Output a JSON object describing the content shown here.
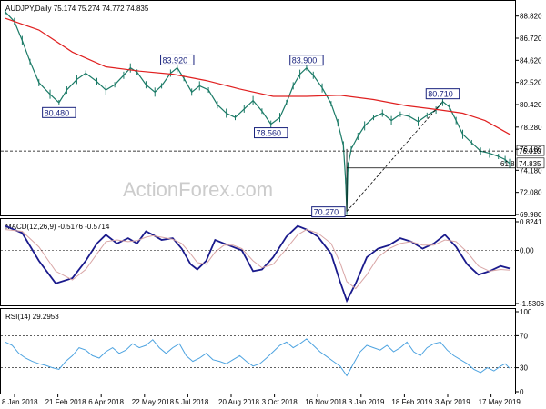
{
  "chart_data": [
    {
      "type": "ohlc",
      "header": "AUDJPY,Daily  75.174 75.274 74.772 74.835",
      "ylim": [
        69.98,
        90.0
      ],
      "y_ticks": [
        "88.820",
        "86.720",
        "84.620",
        "82.520",
        "80.420",
        "78.280",
        "76.180",
        "74.180",
        "72.080",
        "69.980"
      ],
      "y_tick_values": [
        88.82,
        86.72,
        84.62,
        82.52,
        80.42,
        78.28,
        76.18,
        74.18,
        72.08,
        69.98
      ],
      "x_labels": [
        "8 Jan 2018",
        "21 Feb 2018",
        "6 Apr 2018",
        "22 May 2018",
        "5 Jul 2018",
        "20 Aug 2018",
        "3 Oct 2018",
        "16 Nov 2018",
        "3 Jan 2019",
        "18 Feb 2019",
        "3 Apr 2019",
        "17 May 2019"
      ],
      "price_path": [
        [
          0,
          89.2
        ],
        [
          8,
          88.3
        ],
        [
          15,
          86.5
        ],
        [
          22,
          84.5
        ],
        [
          30,
          82.5
        ],
        [
          40,
          81.4
        ],
        [
          48,
          80.6
        ],
        [
          55,
          81.8
        ],
        [
          64,
          82.8
        ],
        [
          72,
          83.4
        ],
        [
          82,
          82.6
        ],
        [
          90,
          81.8
        ],
        [
          98,
          82.3
        ],
        [
          106,
          83.2
        ],
        [
          112,
          83.9
        ],
        [
          118,
          83.5
        ],
        [
          126,
          82.3
        ],
        [
          134,
          81.6
        ],
        [
          140,
          82.2
        ],
        [
          148,
          83.4
        ],
        [
          154,
          83.92
        ],
        [
          160,
          82.9
        ],
        [
          167,
          81.6
        ],
        [
          174,
          82.2
        ],
        [
          182,
          81.8
        ],
        [
          190,
          80.4
        ],
        [
          198,
          79.6
        ],
        [
          206,
          79.2
        ],
        [
          214,
          80.0
        ],
        [
          222,
          80.8
        ],
        [
          230,
          79.8
        ],
        [
          238,
          78.56
        ],
        [
          246,
          79.2
        ],
        [
          252,
          80.6
        ],
        [
          258,
          82.2
        ],
        [
          264,
          83.3
        ],
        [
          270,
          83.9
        ],
        [
          276,
          83.2
        ],
        [
          284,
          82.0
        ],
        [
          292,
          80.5
        ],
        [
          298,
          78.7
        ],
        [
          303,
          76.5
        ],
        [
          305,
          73.2
        ],
        [
          306,
          70.27
        ],
        [
          307,
          74.5
        ],
        [
          310,
          76.2
        ],
        [
          316,
          77.4
        ],
        [
          322,
          78.4
        ],
        [
          330,
          79.2
        ],
        [
          338,
          79.6
        ],
        [
          346,
          78.9
        ],
        [
          354,
          79.5
        ],
        [
          362,
          79.3
        ],
        [
          370,
          78.8
        ],
        [
          378,
          79.4
        ],
        [
          386,
          79.9
        ],
        [
          392,
          80.71
        ],
        [
          398,
          80.2
        ],
        [
          404,
          78.9
        ],
        [
          410,
          77.6
        ],
        [
          418,
          76.8
        ],
        [
          426,
          76.0
        ],
        [
          434,
          75.8
        ],
        [
          442,
          75.5
        ],
        [
          448,
          75.2
        ],
        [
          452,
          74.83
        ]
      ],
      "moving_average_path": [
        [
          0,
          88.6
        ],
        [
          30,
          87.5
        ],
        [
          60,
          85.4
        ],
        [
          90,
          84.0
        ],
        [
          120,
          83.6
        ],
        [
          150,
          83.3
        ],
        [
          180,
          82.7
        ],
        [
          210,
          81.9
        ],
        [
          240,
          81.2
        ],
        [
          270,
          81.2
        ],
        [
          300,
          81.3
        ],
        [
          330,
          80.9
        ],
        [
          360,
          80.3
        ],
        [
          390,
          79.9
        ],
        [
          410,
          79.6
        ],
        [
          430,
          78.9
        ],
        [
          452,
          77.6
        ]
      ],
      "last_price": "74.835",
      "level_line": "76.010",
      "fib_label": "61.8",
      "callouts": [
        {
          "label": "80.480",
          "x": 48,
          "y": 80.48
        },
        {
          "label": "83.920",
          "x": 154,
          "y": 83.92
        },
        {
          "label": "78.560",
          "x": 238,
          "y": 78.56
        },
        {
          "label": "83.900",
          "x": 270,
          "y": 83.9
        },
        {
          "label": "70.270",
          "x": 306,
          "y": 70.27
        },
        {
          "label": "80.710",
          "x": 392,
          "y": 80.71
        }
      ],
      "watermark": "ActionForex.com"
    },
    {
      "type": "line",
      "header": "MACD(12,26,9) -0.5176 -0.5714",
      "ylim": [
        -1.5306,
        0.8241
      ],
      "y_ticks": [
        "0.8241",
        "0.00",
        "-1.5306"
      ],
      "y_tick_values": [
        0.8241,
        0.0,
        -1.5306
      ],
      "series": [
        {
          "color": "#1a1a8c",
          "points": [
            [
              0,
              0.7
            ],
            [
              15,
              0.5
            ],
            [
              30,
              -0.3
            ],
            [
              45,
              -0.95
            ],
            [
              60,
              -0.8
            ],
            [
              72,
              -0.3
            ],
            [
              82,
              0.2
            ],
            [
              90,
              0.45
            ],
            [
              100,
              0.2
            ],
            [
              110,
              0.35
            ],
            [
              118,
              0.2
            ],
            [
              126,
              0.55
            ],
            [
              132,
              0.45
            ],
            [
              140,
              0.3
            ],
            [
              150,
              0.35
            ],
            [
              158,
              0.05
            ],
            [
              166,
              -0.4
            ],
            [
              172,
              -0.55
            ],
            [
              180,
              -0.3
            ],
            [
              188,
              0.3
            ],
            [
              196,
              0.2
            ],
            [
              204,
              0.1
            ],
            [
              212,
              0.0
            ],
            [
              222,
              -0.6
            ],
            [
              230,
              -0.55
            ],
            [
              240,
              -0.2
            ],
            [
              252,
              0.4
            ],
            [
              262,
              0.7
            ],
            [
              270,
              0.6
            ],
            [
              280,
              0.4
            ],
            [
              292,
              -0.1
            ],
            [
              300,
              -0.9
            ],
            [
              306,
              -1.45
            ],
            [
              314,
              -0.95
            ],
            [
              324,
              -0.2
            ],
            [
              334,
              0.05
            ],
            [
              344,
              0.15
            ],
            [
              354,
              0.35
            ],
            [
              364,
              0.25
            ],
            [
              374,
              0.05
            ],
            [
              384,
              0.2
            ],
            [
              394,
              0.45
            ],
            [
              404,
              0.1
            ],
            [
              414,
              -0.4
            ],
            [
              424,
              -0.7
            ],
            [
              434,
              -0.6
            ],
            [
              444,
              -0.45
            ],
            [
              452,
              -0.52
            ]
          ]
        },
        {
          "color": "#d9a6a6",
          "points": [
            [
              0,
              0.6
            ],
            [
              15,
              0.55
            ],
            [
              30,
              0.1
            ],
            [
              45,
              -0.6
            ],
            [
              60,
              -0.85
            ],
            [
              72,
              -0.55
            ],
            [
              82,
              -0.1
            ],
            [
              90,
              0.25
            ],
            [
              100,
              0.3
            ],
            [
              110,
              0.25
            ],
            [
              118,
              0.28
            ],
            [
              126,
              0.38
            ],
            [
              132,
              0.42
            ],
            [
              140,
              0.38
            ],
            [
              150,
              0.32
            ],
            [
              158,
              0.2
            ],
            [
              166,
              -0.1
            ],
            [
              172,
              -0.35
            ],
            [
              180,
              -0.4
            ],
            [
              188,
              -0.05
            ],
            [
              196,
              0.15
            ],
            [
              204,
              0.15
            ],
            [
              212,
              0.05
            ],
            [
              222,
              -0.3
            ],
            [
              230,
              -0.5
            ],
            [
              240,
              -0.4
            ],
            [
              252,
              0.05
            ],
            [
              262,
              0.45
            ],
            [
              270,
              0.6
            ],
            [
              280,
              0.5
            ],
            [
              292,
              0.2
            ],
            [
              300,
              -0.35
            ],
            [
              306,
              -0.9
            ],
            [
              314,
              -1.1
            ],
            [
              324,
              -0.7
            ],
            [
              334,
              -0.2
            ],
            [
              344,
              0.05
            ],
            [
              354,
              0.2
            ],
            [
              364,
              0.25
            ],
            [
              374,
              0.15
            ],
            [
              384,
              0.15
            ],
            [
              394,
              0.3
            ],
            [
              404,
              0.25
            ],
            [
              414,
              -0.05
            ],
            [
              424,
              -0.45
            ],
            [
              434,
              -0.6
            ],
            [
              444,
              -0.55
            ],
            [
              452,
              -0.57
            ]
          ]
        }
      ]
    },
    {
      "type": "line",
      "header": "RSI(14) 29.2953",
      "ylim": [
        0,
        100
      ],
      "y_ticks": [
        "100",
        "70",
        "30",
        "0"
      ],
      "y_tick_values": [
        100,
        70,
        30,
        0
      ],
      "series": [
        {
          "color": "#4da3e0",
          "points": [
            [
              0,
              62
            ],
            [
              6,
              58
            ],
            [
              12,
              48
            ],
            [
              18,
              42
            ],
            [
              24,
              38
            ],
            [
              30,
              35
            ],
            [
              36,
              33
            ],
            [
              42,
              30
            ],
            [
              48,
              28
            ],
            [
              54,
              38
            ],
            [
              60,
              45
            ],
            [
              66,
              55
            ],
            [
              72,
              52
            ],
            [
              78,
              45
            ],
            [
              84,
              42
            ],
            [
              90,
              50
            ],
            [
              96,
              55
            ],
            [
              102,
              48
            ],
            [
              108,
              52
            ],
            [
              114,
              60
            ],
            [
              120,
              55
            ],
            [
              126,
              58
            ],
            [
              132,
              65
            ],
            [
              138,
              55
            ],
            [
              144,
              48
            ],
            [
              150,
              55
            ],
            [
              156,
              60
            ],
            [
              162,
              45
            ],
            [
              168,
              38
            ],
            [
              174,
              42
            ],
            [
              180,
              48
            ],
            [
              186,
              40
            ],
            [
              192,
              38
            ],
            [
              198,
              35
            ],
            [
              204,
              40
            ],
            [
              210,
              45
            ],
            [
              216,
              38
            ],
            [
              222,
              32
            ],
            [
              228,
              35
            ],
            [
              234,
              42
            ],
            [
              240,
              50
            ],
            [
              246,
              58
            ],
            [
              252,
              62
            ],
            [
              258,
              55
            ],
            [
              264,
              60
            ],
            [
              270,
              66
            ],
            [
              276,
              58
            ],
            [
              282,
              50
            ],
            [
              288,
              44
            ],
            [
              294,
              38
            ],
            [
              300,
              32
            ],
            [
              306,
              20
            ],
            [
              312,
              35
            ],
            [
              318,
              50
            ],
            [
              324,
              58
            ],
            [
              330,
              55
            ],
            [
              336,
              52
            ],
            [
              342,
              58
            ],
            [
              348,
              50
            ],
            [
              354,
              55
            ],
            [
              360,
              62
            ],
            [
              366,
              50
            ],
            [
              372,
              45
            ],
            [
              378,
              55
            ],
            [
              384,
              60
            ],
            [
              390,
              62
            ],
            [
              396,
              52
            ],
            [
              402,
              45
            ],
            [
              408,
              40
            ],
            [
              414,
              35
            ],
            [
              420,
              28
            ],
            [
              426,
              24
            ],
            [
              432,
              30
            ],
            [
              438,
              26
            ],
            [
              444,
              32
            ],
            [
              448,
              35
            ],
            [
              452,
              29.3
            ]
          ]
        }
      ]
    }
  ],
  "x_axis_labels": [
    "8 Jan 2018",
    "21 Feb 2018",
    "6 Apr 2018",
    "22 May 2018",
    "5 Jul 2018",
    "20 Aug 2018",
    "3 Oct 2018",
    "16 Nov 2018",
    "3 Jan 2019",
    "18 Feb 2019",
    "3 Apr 2019",
    "17 May 2019"
  ]
}
